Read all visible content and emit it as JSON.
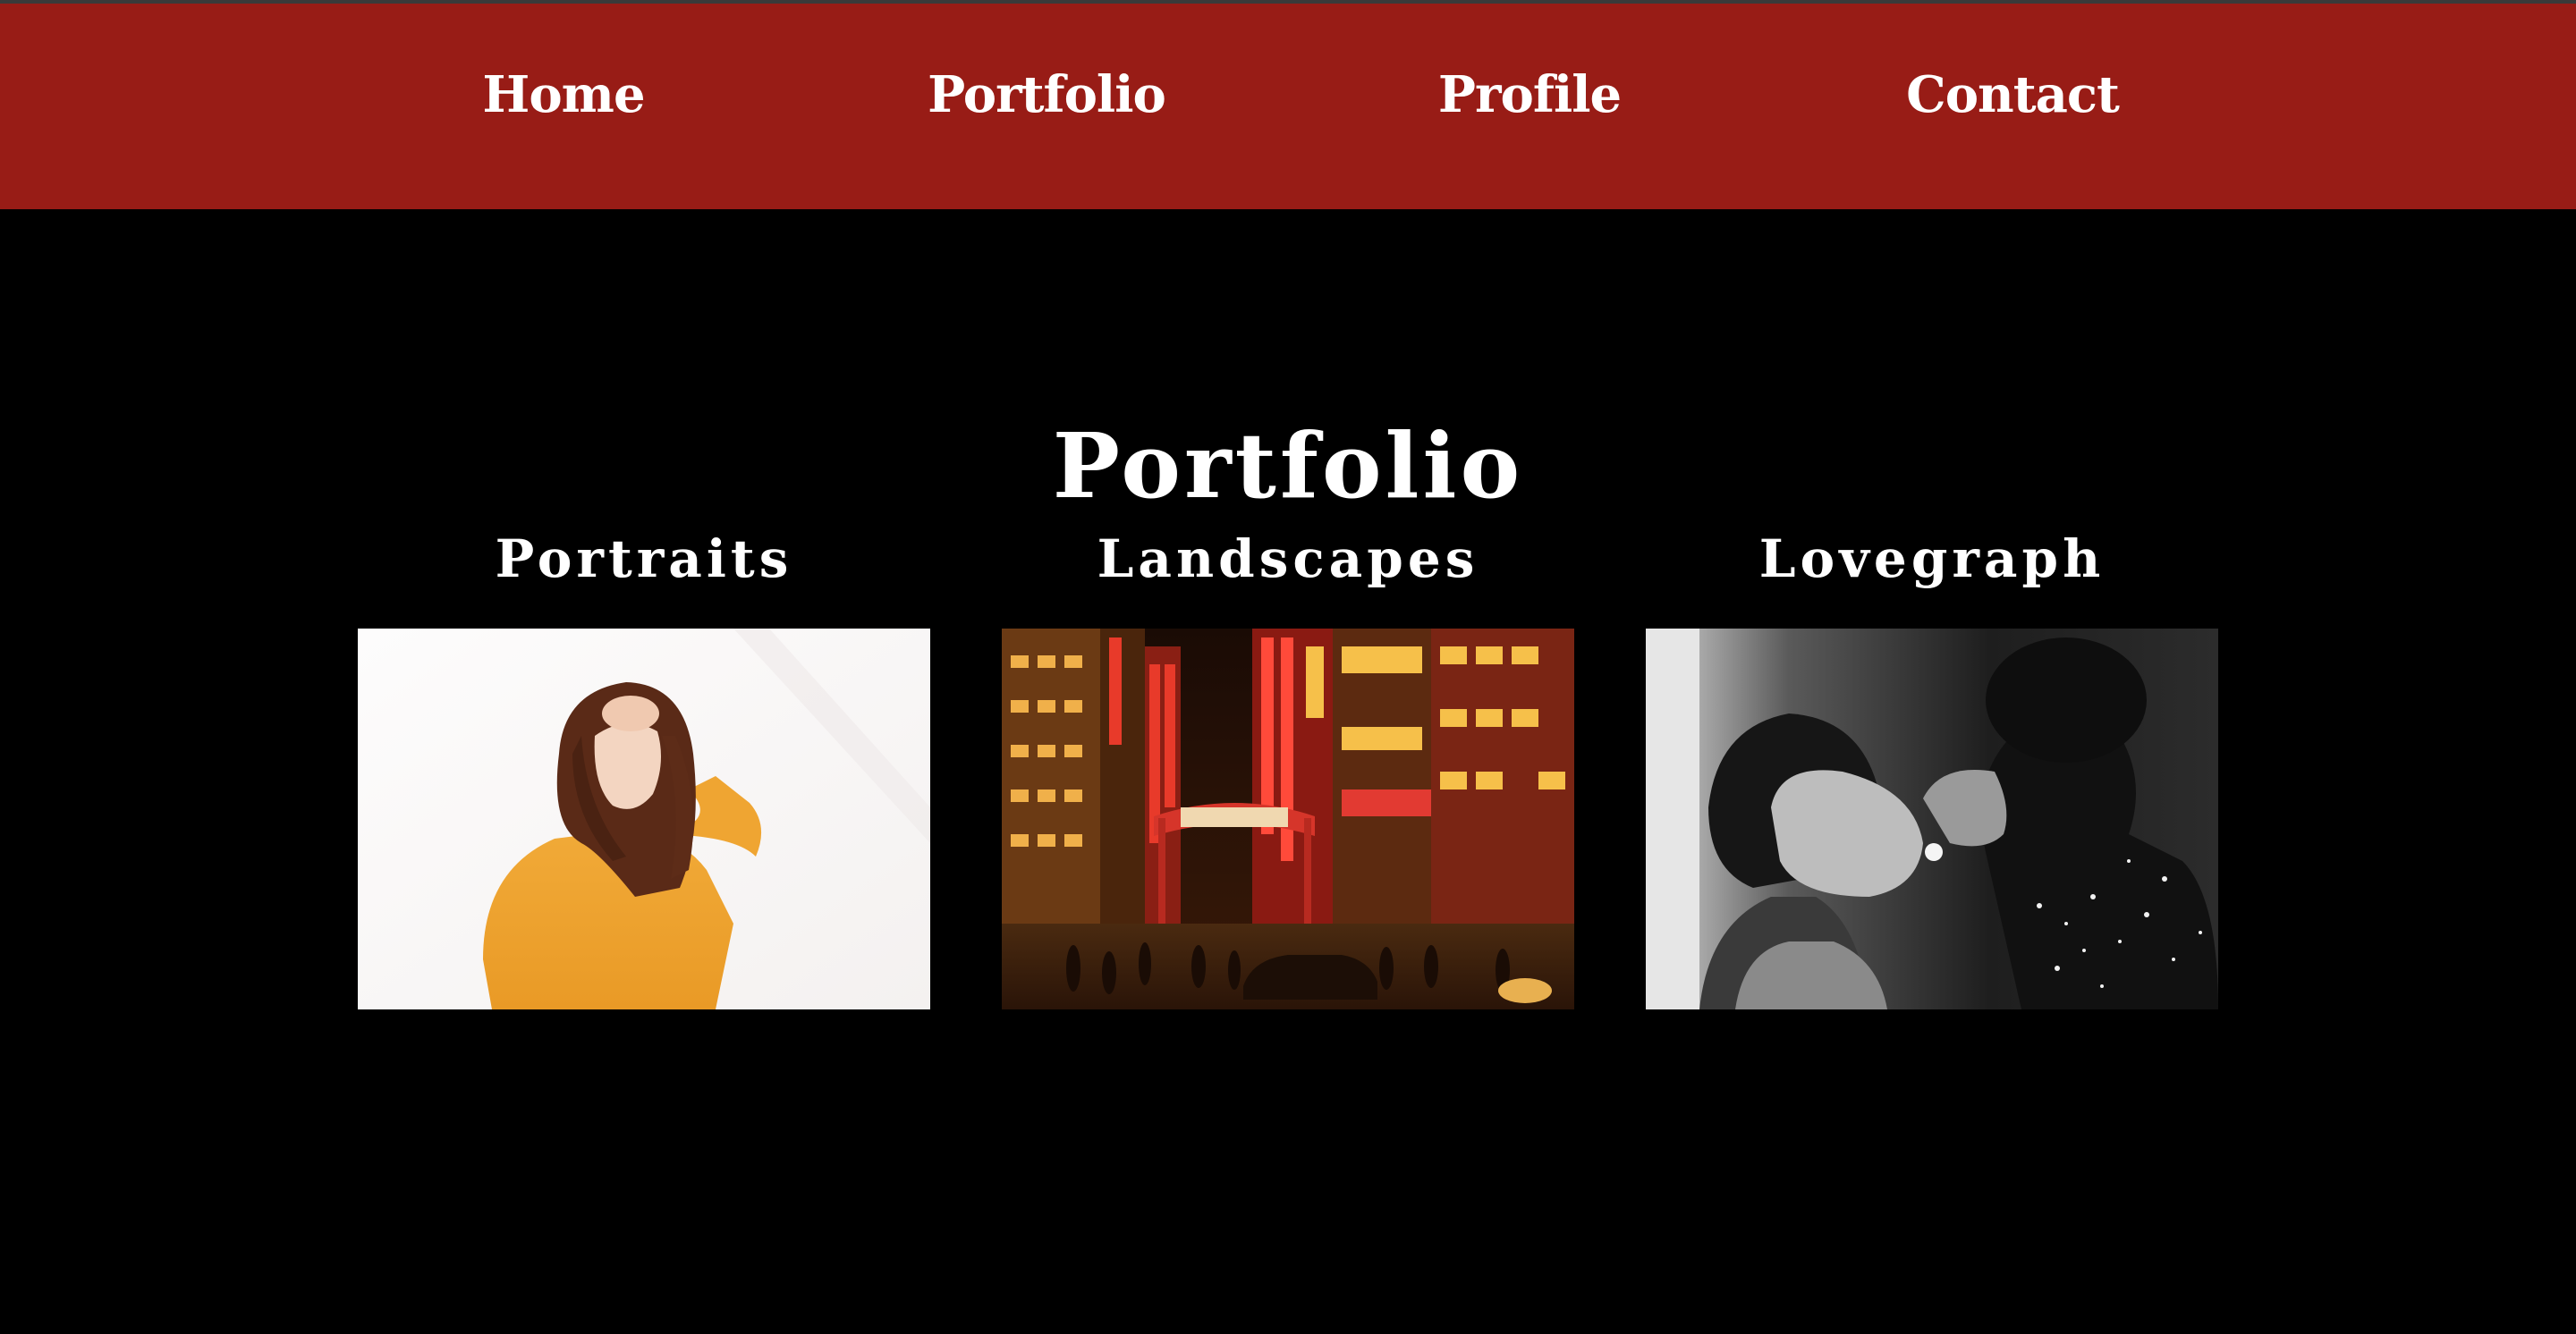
{
  "nav": {
    "items": [
      {
        "label": "Home"
      },
      {
        "label": "Portfolio"
      },
      {
        "label": "Profile"
      },
      {
        "label": "Contact"
      }
    ]
  },
  "page": {
    "title": "Portfolio"
  },
  "categories": [
    {
      "label": "Portraits",
      "image": "portrait-photo-woman-orange-sweater"
    },
    {
      "label": "Landscapes",
      "image": "city-night-neon-street-photo"
    },
    {
      "label": "Lovegraph",
      "image": "black-and-white-couple-photo"
    }
  ],
  "colors": {
    "nav_background": "#981c16",
    "page_background": "#000000",
    "text": "#ffffff"
  }
}
